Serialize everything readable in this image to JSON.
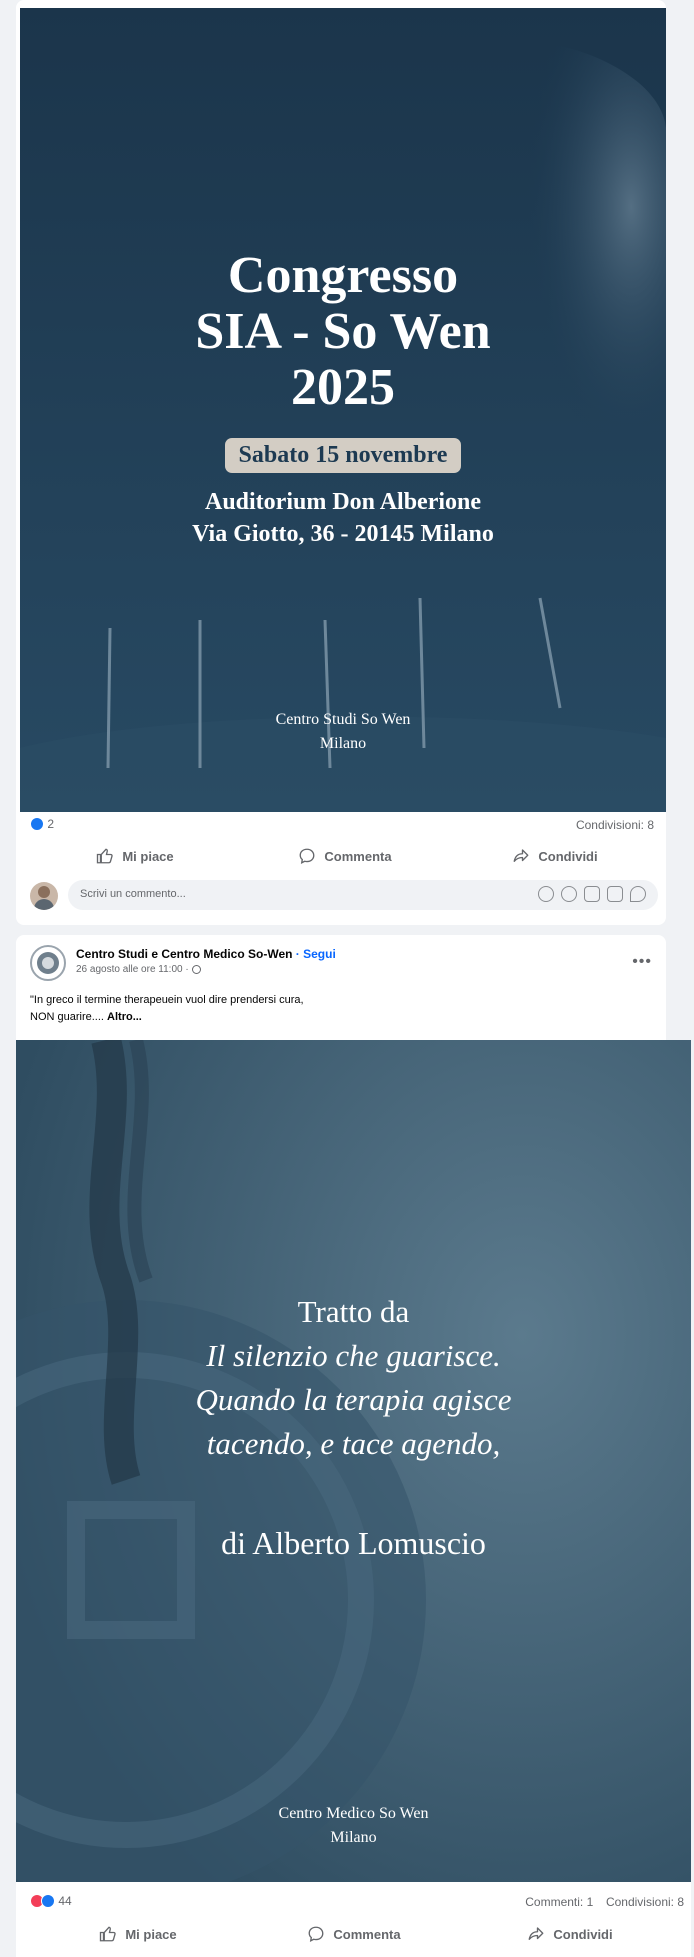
{
  "post1": {
    "image": {
      "title_lines": [
        "Congresso",
        "SIA - So Wen",
        "2025"
      ],
      "date_pill": "Sabato 15 novembre",
      "venue_lines": [
        "Auditorium Don Alberione",
        "Via Giotto, 36 - 20145 Milano"
      ],
      "footer_lines": [
        "Centro Studi So Wen",
        "Milano"
      ]
    },
    "reactions_count": "2",
    "shares": "Condivisioni: 8",
    "actions": {
      "like": "Mi piace",
      "comment": "Commenta",
      "share": "Condividi"
    },
    "comment_placeholder": "Scrivi un commento..."
  },
  "post2": {
    "page_name": "Centro Studi e Centro Medico So-Wen",
    "follow": "· Segui",
    "timestamp": "26 agosto alle ore 11:00 ·",
    "text_line1": "\"In greco il termine therapeuein vuol dire prendersi cura,",
    "text_line2": "NON guarire....",
    "more": "Altro...",
    "image": {
      "line1": "Tratto da",
      "line2": "Il silenzio che guarisce.",
      "line3": "Quando la terapia agisce",
      "line4": "tacendo, e tace agendo,",
      "author": "di Alberto Lomuscio",
      "footer_lines": [
        "Centro Medico So Wen",
        "Milano"
      ]
    },
    "reactions_count": "44",
    "comments": "Commenti: 1",
    "shares": "Condivisioni: 8",
    "actions": {
      "like": "Mi piace",
      "comment": "Commenta",
      "share": "Condividi"
    }
  },
  "colors": {
    "like_blue": "#1877f2",
    "love_red": "#f33e58",
    "follow_blue": "#0866ff",
    "poster1_bg": "#1d3a52",
    "poster2_bg": "#3d5c70"
  }
}
